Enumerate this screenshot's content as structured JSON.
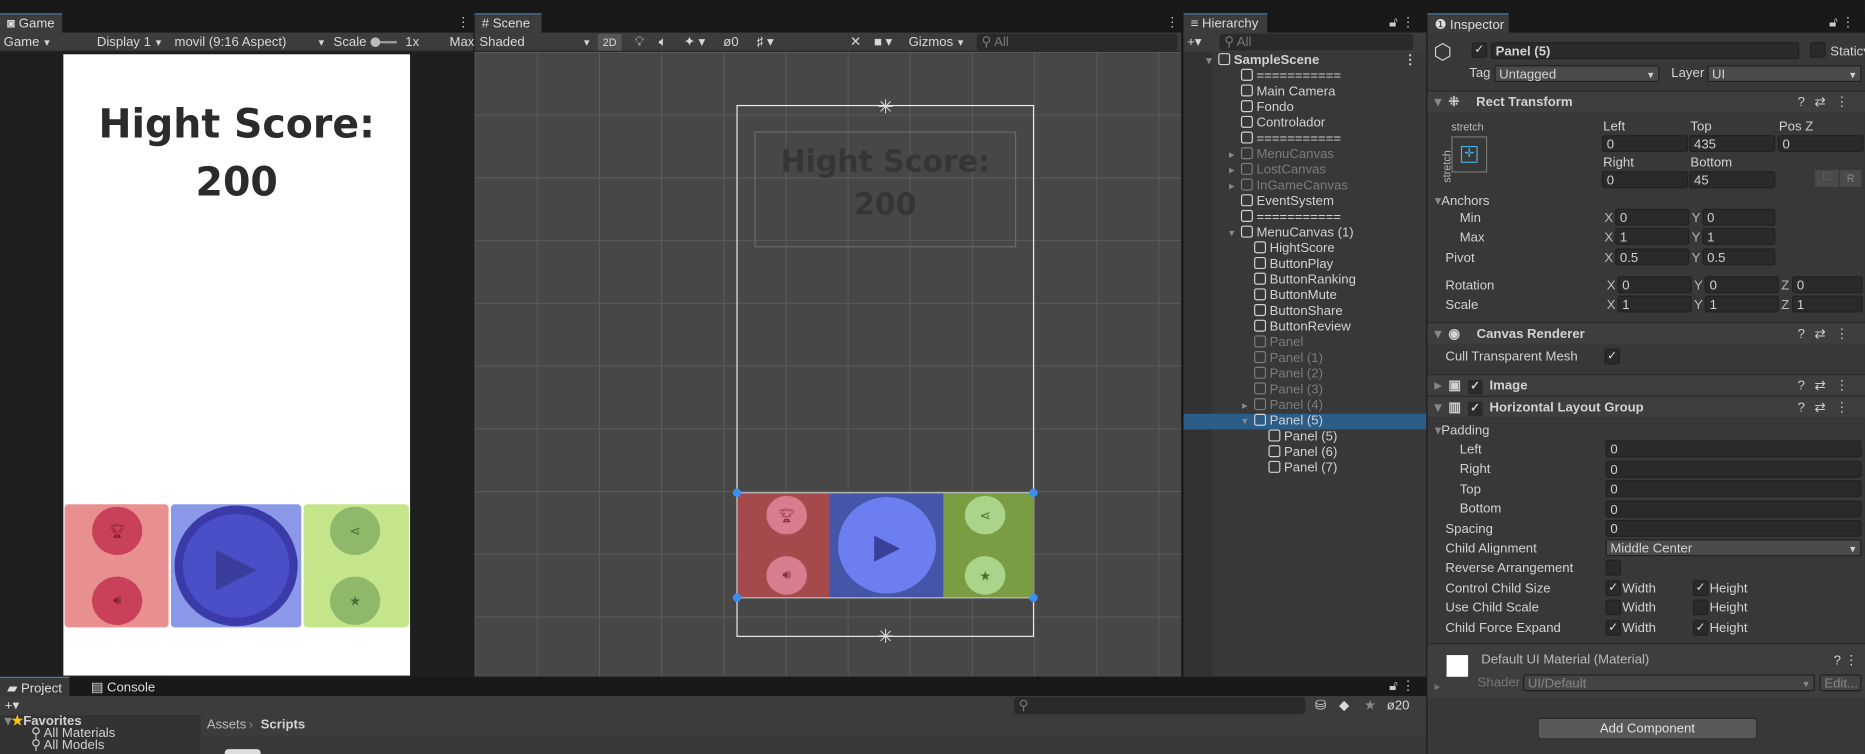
{
  "game": {
    "tab": "Game",
    "mode": "Game",
    "display": "Display 1",
    "aspect": "movil (9:16 Aspect)",
    "scale_label": "Scale",
    "scale_value": "1x",
    "max": "Max",
    "title_line1": "Hight Score:",
    "title_line2": "200"
  },
  "scene": {
    "tab": "Scene",
    "shading": "Shaded",
    "btn_2d": "2D",
    "hidden_count": "0",
    "gizmos": "Gizmos",
    "search_placeholder": "All"
  },
  "hierarchy": {
    "tab": "Hierarchy",
    "search_placeholder": "All",
    "items": [
      {
        "label": "SampleScene",
        "level": 0,
        "dim": false
      },
      {
        "label": "===========",
        "level": 1,
        "dim": false
      },
      {
        "label": "Main Camera",
        "level": 1,
        "dim": false
      },
      {
        "label": "Fondo",
        "level": 1,
        "dim": false
      },
      {
        "label": "Controlador",
        "level": 1,
        "dim": false
      },
      {
        "label": "===========",
        "level": 1,
        "dim": false
      },
      {
        "label": "MenuCanvas",
        "level": 1,
        "dim": true
      },
      {
        "label": "LostCanvas",
        "level": 1,
        "dim": true
      },
      {
        "label": "InGameCanvas",
        "level": 1,
        "dim": true
      },
      {
        "label": "EventSystem",
        "level": 1,
        "dim": false
      },
      {
        "label": "===========",
        "level": 1,
        "dim": false
      },
      {
        "label": "MenuCanvas (1)",
        "level": 1,
        "dim": false
      },
      {
        "label": "HightScore",
        "level": 2,
        "dim": false
      },
      {
        "label": "ButtonPlay",
        "level": 2,
        "dim": false
      },
      {
        "label": "ButtonRanking",
        "level": 2,
        "dim": false
      },
      {
        "label": "ButtonMute",
        "level": 2,
        "dim": false
      },
      {
        "label": "ButtonShare",
        "level": 2,
        "dim": false
      },
      {
        "label": "ButtonReview",
        "level": 2,
        "dim": false
      },
      {
        "label": "Panel",
        "level": 2,
        "dim": true
      },
      {
        "label": "Panel (1)",
        "level": 2,
        "dim": true
      },
      {
        "label": "Panel (2)",
        "level": 2,
        "dim": true
      },
      {
        "label": "Panel (3)",
        "level": 2,
        "dim": true
      },
      {
        "label": "Panel (4)",
        "level": 2,
        "dim": true
      },
      {
        "label": "Panel (5)",
        "level": 2,
        "dim": false,
        "selected": true
      },
      {
        "label": "Panel (5)",
        "level": 3,
        "dim": false
      },
      {
        "label": "Panel (6)",
        "level": 3,
        "dim": false
      },
      {
        "label": "Panel (7)",
        "level": 3,
        "dim": false
      }
    ]
  },
  "inspector": {
    "tab": "Inspector",
    "object_name": "Panel (5)",
    "static": "Static",
    "tag_label": "Tag",
    "tag": "Untagged",
    "layer_label": "Layer",
    "layer": "UI",
    "rect": {
      "title": "Rect Transform",
      "stretch": "stretch",
      "left_l": "Left",
      "left": "0",
      "top_l": "Top",
      "top": "435",
      "posz_l": "Pos Z",
      "posz": "0",
      "right_l": "Right",
      "right": "0",
      "bottom_l": "Bottom",
      "bottom": "45",
      "r_btn": "R",
      "anchors": "Anchors",
      "min": "Min",
      "max": "Max",
      "min_x": "0",
      "min_y": "0",
      "max_x": "1",
      "max_y": "1",
      "pivot": "Pivot",
      "pivot_x": "0.5",
      "pivot_y": "0.5",
      "rotation": "Rotation",
      "rot_x": "0",
      "rot_y": "0",
      "rot_z": "0",
      "scale": "Scale",
      "sc_x": "1",
      "sc_y": "1",
      "sc_z": "1"
    },
    "canvas_renderer": {
      "title": "Canvas Renderer",
      "cull": "Cull Transparent Mesh"
    },
    "image": {
      "title": "Image"
    },
    "hlg": {
      "title": "Horizontal Layout Group",
      "padding": "Padding",
      "left_l": "Left",
      "left": "0",
      "right_l": "Right",
      "right": "0",
      "top_l": "Top",
      "top": "0",
      "bottom_l": "Bottom",
      "bottom": "0",
      "spacing_l": "Spacing",
      "spacing": "0",
      "align_l": "Child Alignment",
      "align": "Middle Center",
      "reverse": "Reverse Arrangement",
      "ccs": "Control Child Size",
      "ucs": "Use Child Scale",
      "cfe": "Child Force Expand",
      "width": "Width",
      "height": "Height"
    },
    "material": {
      "name": "Default UI Material (Material)",
      "shader_l": "Shader",
      "shader": "UI/Default",
      "edit": "Edit..."
    },
    "add_component": "Add Component"
  },
  "project": {
    "tab_project": "Project",
    "tab_console": "Console",
    "favorites": "Favorites",
    "fav_items": [
      "All Materials",
      "All Models"
    ],
    "breadcrumb_root": "Assets",
    "breadcrumb_leaf": "Scripts",
    "hidden_count": "20"
  }
}
